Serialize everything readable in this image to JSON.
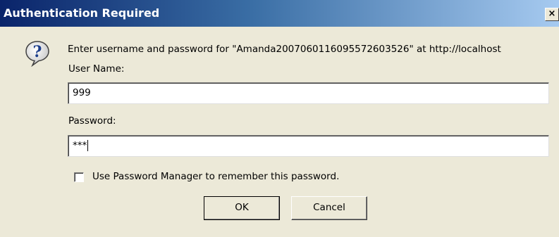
{
  "window": {
    "title": "Authentication Required",
    "close_glyph": "×"
  },
  "icon": {
    "name": "question-icon"
  },
  "prompt": "Enter username and password for \"Amanda20070601160955726035​26\" at http://localhost",
  "fields": {
    "username": {
      "label": "User Name:",
      "value": "999"
    },
    "password": {
      "label": "Password:",
      "value": "***"
    }
  },
  "remember": {
    "label": "Use Password Manager to remember this password.",
    "checked": false
  },
  "buttons": {
    "ok": "OK",
    "cancel": "Cancel"
  },
  "colors": {
    "titlebar_start": "#0a246a",
    "titlebar_end": "#a6caf0",
    "dialog_bg": "#ece9d8"
  }
}
